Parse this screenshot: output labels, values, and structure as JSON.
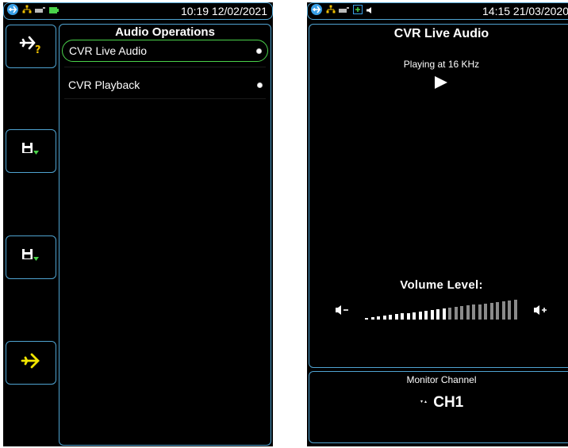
{
  "left_screen": {
    "status": {
      "time": "10:19 12/02/2021"
    },
    "panel": {
      "title": "Audio Operations",
      "items": [
        {
          "label": "CVR Live Audio",
          "selected": true
        },
        {
          "label": "CVR Playback",
          "selected": false
        }
      ]
    },
    "sidebar": [
      "plane-question-icon",
      "save-download-icon",
      "save-download-icon",
      "plane-icon"
    ]
  },
  "right_screen": {
    "status": {
      "time": "14:15 21/03/2020"
    },
    "title": "CVR Live Audio",
    "playing_text": "Playing at 16 KHz",
    "volume_label": "Volume Level:",
    "volume": {
      "segments": 26,
      "active": 14
    },
    "monitor_title": "Monitor Channel",
    "channel": "CH1"
  },
  "colors": {
    "border": "#4fa3d1",
    "accent_green": "#4ad24a",
    "plane_yellow": "#f2e600",
    "plane_blue": "#3aa0e6"
  }
}
